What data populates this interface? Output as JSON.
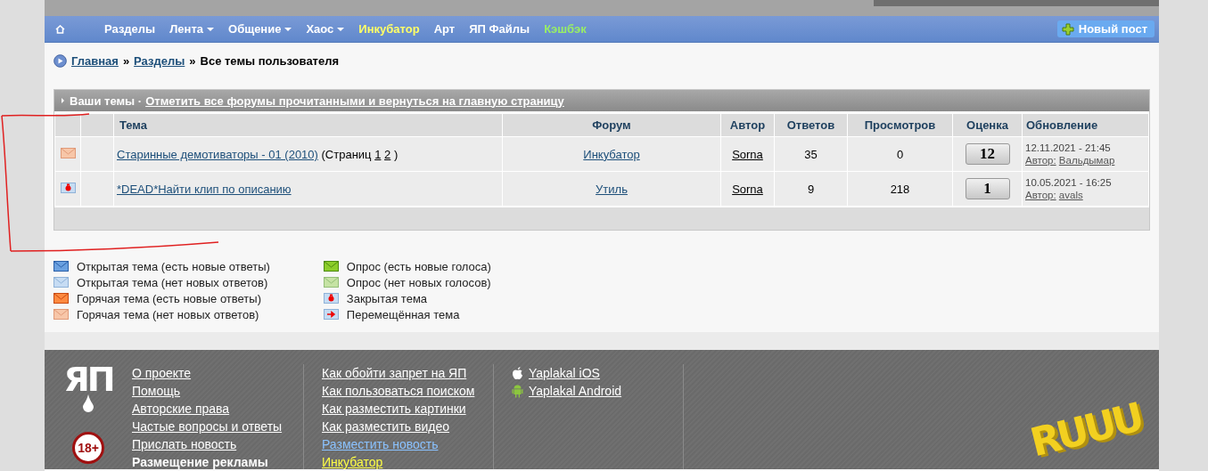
{
  "nav": {
    "items": [
      {
        "label": "Разделы",
        "dropdown": false,
        "color": "#ffffff"
      },
      {
        "label": "Лента",
        "dropdown": true,
        "color": "#ffffff"
      },
      {
        "label": "Общение",
        "dropdown": true,
        "color": "#ffffff"
      },
      {
        "label": "Хаос",
        "dropdown": true,
        "color": "#ffffff"
      },
      {
        "label": "Инкубатор",
        "dropdown": false,
        "color": "#ffff66"
      },
      {
        "label": "Арт",
        "dropdown": false,
        "color": "#ffffff"
      },
      {
        "label": "ЯП Файлы",
        "dropdown": false,
        "color": "#ffffff"
      },
      {
        "label": "Кэшбэк",
        "dropdown": false,
        "color": "#99ee66"
      }
    ],
    "new_post": "Новый пост"
  },
  "breadcrumb": {
    "links": [
      "Главная",
      "Разделы"
    ],
    "separator": "»",
    "current": "Все темы пользователя"
  },
  "topics": {
    "title": "Ваши темы ·",
    "action_link": "Отметить все форумы прочитанными и вернуться на главную страницу",
    "columns": [
      "Тема",
      "Форум",
      "Автор",
      "Ответов",
      "Просмотров",
      "Оценка",
      "Обновление"
    ],
    "rows": [
      {
        "kind": "hot_no_new",
        "title": "Старинные демотиваторы - 01 (2010)",
        "pages_prefix": "(Страниц",
        "pages": [
          "1",
          "2"
        ],
        "pages_suffix": ")",
        "forum": "Инкубатор",
        "author": "Sorna",
        "replies": "35",
        "views": "0",
        "rating": "12",
        "updated": "12.11.2021 - 21:45",
        "last_author_label": "Автор:",
        "last_author": "Вальдымар"
      },
      {
        "kind": "closed",
        "title": "*DEAD*Найти клип по описанию",
        "pages_prefix": "",
        "pages": [],
        "pages_suffix": "",
        "forum": "Утиль",
        "author": "Sorna",
        "replies": "9",
        "views": "218",
        "rating": "1",
        "updated": "10.05.2021 - 16:25",
        "last_author_label": "Автор:",
        "last_author": "avals"
      }
    ]
  },
  "legend": [
    [
      {
        "kind": "open_new",
        "label": "Открытая тема (есть новые ответы)"
      },
      {
        "kind": "open_no_new",
        "label": "Открытая тема (нет новых ответов)"
      },
      {
        "kind": "hot_new",
        "label": "Горячая тема (есть новые ответы)"
      },
      {
        "kind": "hot_no_new",
        "label": "Горячая тема (нет новых ответов)"
      }
    ],
    [
      {
        "kind": "poll_new",
        "label": "Опрос (есть новые голоса)"
      },
      {
        "kind": "poll_no_new",
        "label": "Опрос (нет новых голосов)"
      },
      {
        "kind": "closed",
        "label": "Закрытая тема"
      },
      {
        "kind": "moved",
        "label": "Перемещённая тема"
      }
    ]
  ],
  "footer": {
    "logo": "ЯП",
    "age_badge": "18+",
    "columns": [
      [
        {
          "kind": "link",
          "label": "О проекте"
        },
        {
          "kind": "link",
          "label": "Помощь"
        },
        {
          "kind": "link",
          "label": "Авторские права"
        },
        {
          "kind": "link",
          "label": "Частые вопросы и ответы"
        },
        {
          "kind": "link",
          "label": "Прислать новость"
        },
        {
          "kind": "bold",
          "label": "Размещение рекламы"
        }
      ],
      [
        {
          "kind": "link",
          "label": "Как обойти запрет на ЯП"
        },
        {
          "kind": "link",
          "label": "Как пользоваться поиском"
        },
        {
          "kind": "link",
          "label": "Как разместить картинки"
        },
        {
          "kind": "link",
          "label": "Как разместить видео"
        },
        {
          "kind": "blue",
          "label": "Разместить новость"
        },
        {
          "kind": "yellow",
          "label": "Инкубатор"
        }
      ],
      [
        {
          "kind": "ios",
          "label": "Yaplakal iOS"
        },
        {
          "kind": "android",
          "label": "Yaplakal Android"
        }
      ]
    ],
    "corner_logo": "RUUU"
  }
}
